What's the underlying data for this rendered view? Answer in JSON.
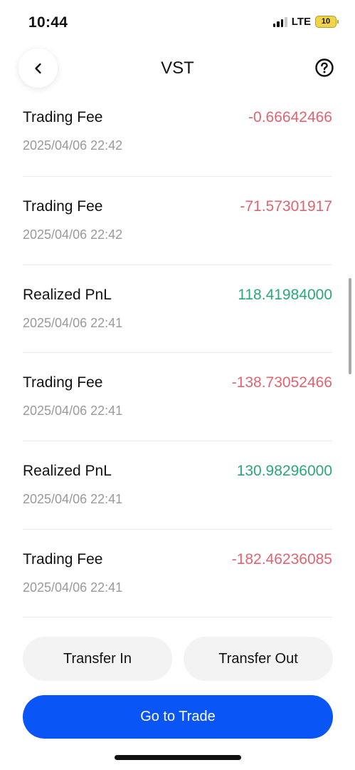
{
  "status_bar": {
    "time": "10:44",
    "network": "LTE",
    "battery": "10"
  },
  "header": {
    "title": "VST",
    "back_icon": "chevron-left-icon",
    "help_icon": "question-circle-icon"
  },
  "colors": {
    "negative": "#e0646f",
    "positive": "#2aa77a",
    "primary": "#0a55f6"
  },
  "records": [
    {
      "type": "Trading Fee",
      "amount": "-0.66642466",
      "date": "2025/04/06 22:42",
      "sign": "neg"
    },
    {
      "type": "Trading Fee",
      "amount": "-71.57301917",
      "date": "2025/04/06 22:42",
      "sign": "neg"
    },
    {
      "type": "Realized PnL",
      "amount": "118.41984000",
      "date": "2025/04/06 22:41",
      "sign": "pos"
    },
    {
      "type": "Trading Fee",
      "amount": "-138.73052466",
      "date": "2025/04/06 22:41",
      "sign": "neg"
    },
    {
      "type": "Realized PnL",
      "amount": "130.98296000",
      "date": "2025/04/06 22:41",
      "sign": "pos"
    },
    {
      "type": "Trading Fee",
      "amount": "-182.46236085",
      "date": "2025/04/06 22:41",
      "sign": "neg"
    }
  ],
  "actions": {
    "transfer_in": "Transfer In",
    "transfer_out": "Transfer Out",
    "go_to_trade": "Go to Trade"
  }
}
